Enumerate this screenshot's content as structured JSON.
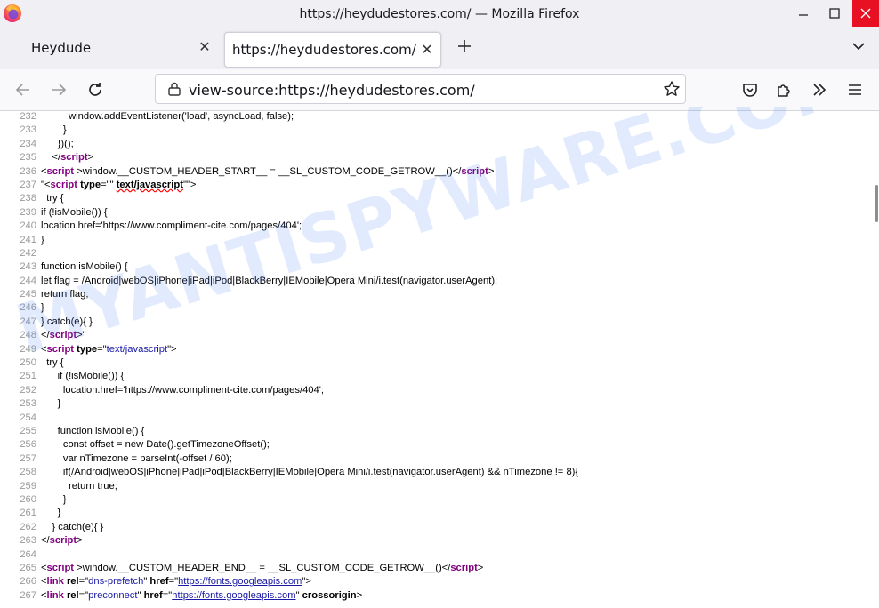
{
  "window": {
    "title": "https://heydudestores.com/ — Mozilla Firefox"
  },
  "tabs": [
    {
      "label": "Heydude",
      "active": false
    },
    {
      "label": "https://heydudestores.com/",
      "active": true
    }
  ],
  "urlbar": {
    "value": "view-source:https://heydudestores.com/"
  },
  "watermark": "MYANTISPYWARE.COM",
  "source_lines": [
    {
      "n": "232",
      "html": "          window.addEventListener('load', asyncLoad, false);"
    },
    {
      "n": "233",
      "html": "        }"
    },
    {
      "n": "234",
      "html": "      })();"
    },
    {
      "n": "235",
      "html": "    &lt;/<span class=\"tag\">script</span>&gt;"
    },
    {
      "n": "236",
      "html": "&lt;<span class=\"tag\">script</span> &gt;window.__CUSTOM_HEADER_START__ = __SL_CUSTOM_CODE_GETROW__()&lt;/<span class=\"tag\">script</span>&gt;"
    },
    {
      "n": "237",
      "html": "\"&lt;<span class=\"tag\">script</span> <span class=\"attr\">type</span>=\"\" <span class=\"attr err\">text/javascript</span>\"\"&gt;"
    },
    {
      "n": "238",
      "html": "  try {"
    },
    {
      "n": "239",
      "html": "if (!isMobile()) {"
    },
    {
      "n": "240",
      "html": "location.href='https://www.compliment-cite.com/pages/404';"
    },
    {
      "n": "241",
      "html": "}"
    },
    {
      "n": "242",
      "html": ""
    },
    {
      "n": "243",
      "html": "function isMobile() {"
    },
    {
      "n": "244",
      "html": "let flag = /Android|webOS|iPhone|iPad|iPod|BlackBerry|IEMobile|Opera Mini/i.test(navigator.userAgent);"
    },
    {
      "n": "245",
      "html": "return flag;"
    },
    {
      "n": "246",
      "html": "}"
    },
    {
      "n": "247",
      "html": "} catch(e){ }"
    },
    {
      "n": "248",
      "html": "&lt;/<span class=\"tag\">script</span>&gt;\""
    },
    {
      "n": "249",
      "html": "&lt;<span class=\"tag\">script</span> <span class=\"attr\">type</span>=\"<span class=\"val\">text/javascript</span>\"&gt;"
    },
    {
      "n": "250",
      "html": "  try {"
    },
    {
      "n": "251",
      "html": "      if (!isMobile()) {"
    },
    {
      "n": "252",
      "html": "        location.href='https://www.compliment-cite.com/pages/404';"
    },
    {
      "n": "253",
      "html": "      }"
    },
    {
      "n": "254",
      "html": ""
    },
    {
      "n": "255",
      "html": "      function isMobile() {"
    },
    {
      "n": "256",
      "html": "        const offset = new Date().getTimezoneOffset();"
    },
    {
      "n": "257",
      "html": "        var nTimezone = parseInt(-offset / 60);"
    },
    {
      "n": "258",
      "html": "        if(/Android|webOS|iPhone|iPad|iPod|BlackBerry|IEMobile|Opera Mini/i.test(navigator.userAgent) &amp;&amp; nTimezone != 8){"
    },
    {
      "n": "259",
      "html": "          return true;"
    },
    {
      "n": "260",
      "html": "        }"
    },
    {
      "n": "261",
      "html": "      }"
    },
    {
      "n": "262",
      "html": "    } catch(e){ }"
    },
    {
      "n": "263",
      "html": "&lt;/<span class=\"tag\">script</span>&gt;"
    },
    {
      "n": "264",
      "html": ""
    },
    {
      "n": "265",
      "html": "&lt;<span class=\"tag\">script</span> &gt;window.__CUSTOM_HEADER_END__ = __SL_CUSTOM_CODE_GETROW__()&lt;/<span class=\"tag\">script</span>&gt;"
    },
    {
      "n": "266",
      "html": "&lt;<span class=\"tag\">link</span> <span class=\"attr\">rel</span>=\"<span class=\"val\">dns-prefetch</span>\" <span class=\"attr\">href</span>=\"<span class=\"link\">https://fonts.googleapis.com</span>\"&gt;"
    },
    {
      "n": "267",
      "html": "&lt;<span class=\"tag\">link</span> <span class=\"attr\">rel</span>=\"<span class=\"val\">preconnect</span>\" <span class=\"attr\">href</span>=\"<span class=\"link\">https://fonts.googleapis.com</span>\" <span class=\"attr\">crossorigin</span>&gt;"
    }
  ]
}
